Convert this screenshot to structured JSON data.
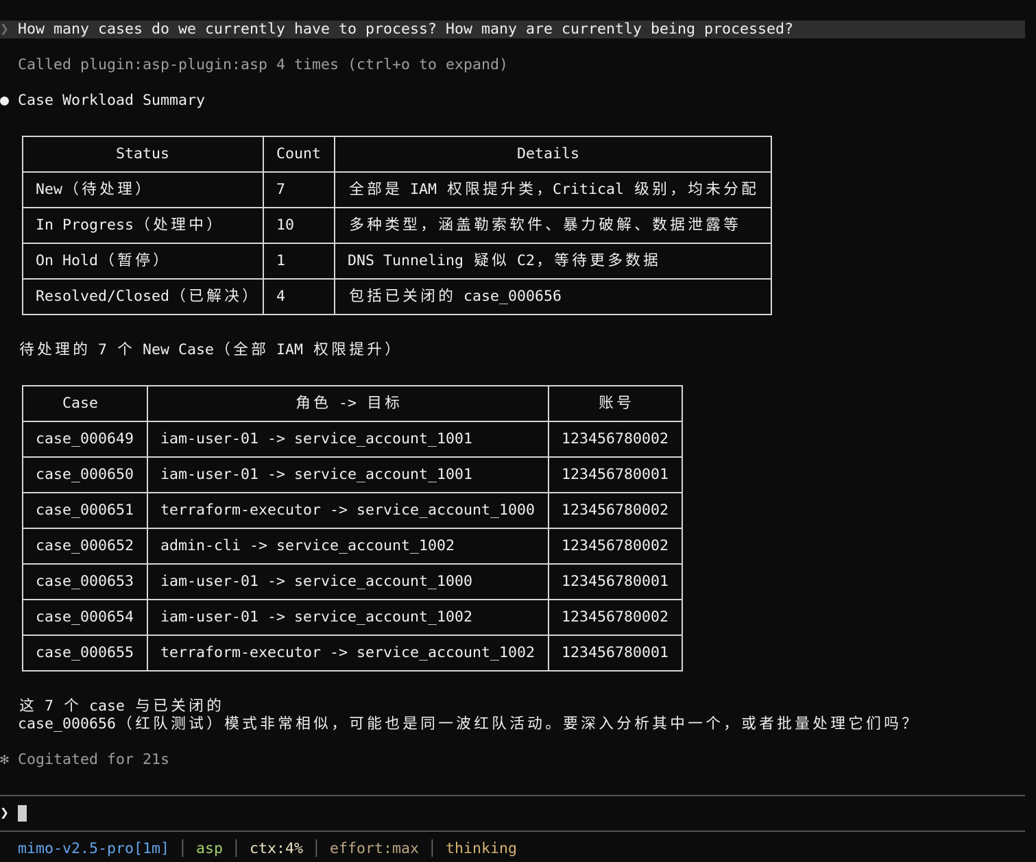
{
  "history": {
    "prompt": {
      "chevron": "❯",
      "text": "How many cases do we currently have to process? How many are currently being processed?"
    },
    "tool_call": "Called plugin:asp-plugin:asp 4 times (ctrl+o to expand)"
  },
  "response": {
    "bullet": "●",
    "title": "Case Workload Summary",
    "status_table": {
      "headers": [
        "Status",
        "Count",
        "Details"
      ],
      "rows": [
        [
          "New（待处理）",
          "7",
          "全部是 IAM 权限提升类，Critical 级别，均未分配"
        ],
        [
          "In Progress（处理中）",
          "10",
          "多种类型，涵盖勒索软件、暴力破解、数据泄露等"
        ],
        [
          "On Hold（暂停）",
          "1",
          "DNS Tunneling 疑似 C2，等待更多数据"
        ],
        [
          "Resolved/Closed（已解决）",
          "4",
          "包括已关闭的 case_000656"
        ]
      ]
    },
    "new_cases_heading": "待处理的 7 个 New Case（全部 IAM 权限提升）",
    "new_cases_table": {
      "headers": [
        "Case",
        "角色 -> 目标",
        "账号"
      ],
      "rows": [
        [
          "case_000649",
          "iam-user-01 -> service_account_1001",
          "123456780002"
        ],
        [
          "case_000650",
          "iam-user-01 -> service_account_1001",
          "123456780001"
        ],
        [
          "case_000651",
          "terraform-executor -> service_account_1000",
          "123456780002"
        ],
        [
          "case_000652",
          "admin-cli -> service_account_1002",
          "123456780002"
        ],
        [
          "case_000653",
          "iam-user-01 -> service_account_1000",
          "123456780001"
        ],
        [
          "case_000654",
          "iam-user-01 -> service_account_1002",
          "123456780002"
        ],
        [
          "case_000655",
          "terraform-executor -> service_account_1002",
          "123456780001"
        ]
      ]
    },
    "followup": [
      "这 7 个 case 与已关闭的",
      "case_000656（红队测试）模式非常相似，可能也是同一波红队活动。要深入分析其中一个，或者批量处理它们吗？"
    ]
  },
  "status": {
    "symbol": "✻",
    "text": "Cogitated for 21s"
  },
  "input": {
    "chevron": "❯",
    "value": ""
  },
  "statusbar": {
    "separator": "│",
    "model": {
      "text": "mimo-v2.5-pro[1m]",
      "color": "#62a6ef"
    },
    "project": {
      "text": "asp",
      "color": "#a3d26d"
    },
    "context": {
      "text": "ctx:4%",
      "color": "#ece3c3"
    },
    "effort": {
      "text": "effort:max",
      "color": "#bca684"
    },
    "thinking": {
      "text": "thinking",
      "color": "#d6b473"
    }
  },
  "colors": {
    "background": "#0c0c0c",
    "text": "#f0f0f0",
    "muted": "#9e9e9e",
    "dim_chevron": "#6e6e6e",
    "prompt_highlight": "#2e2e2e",
    "table_border": "#d6d6d6",
    "divider": "#555555",
    "cursor": "#cfcfcf",
    "separator": "#6a6a6a"
  }
}
